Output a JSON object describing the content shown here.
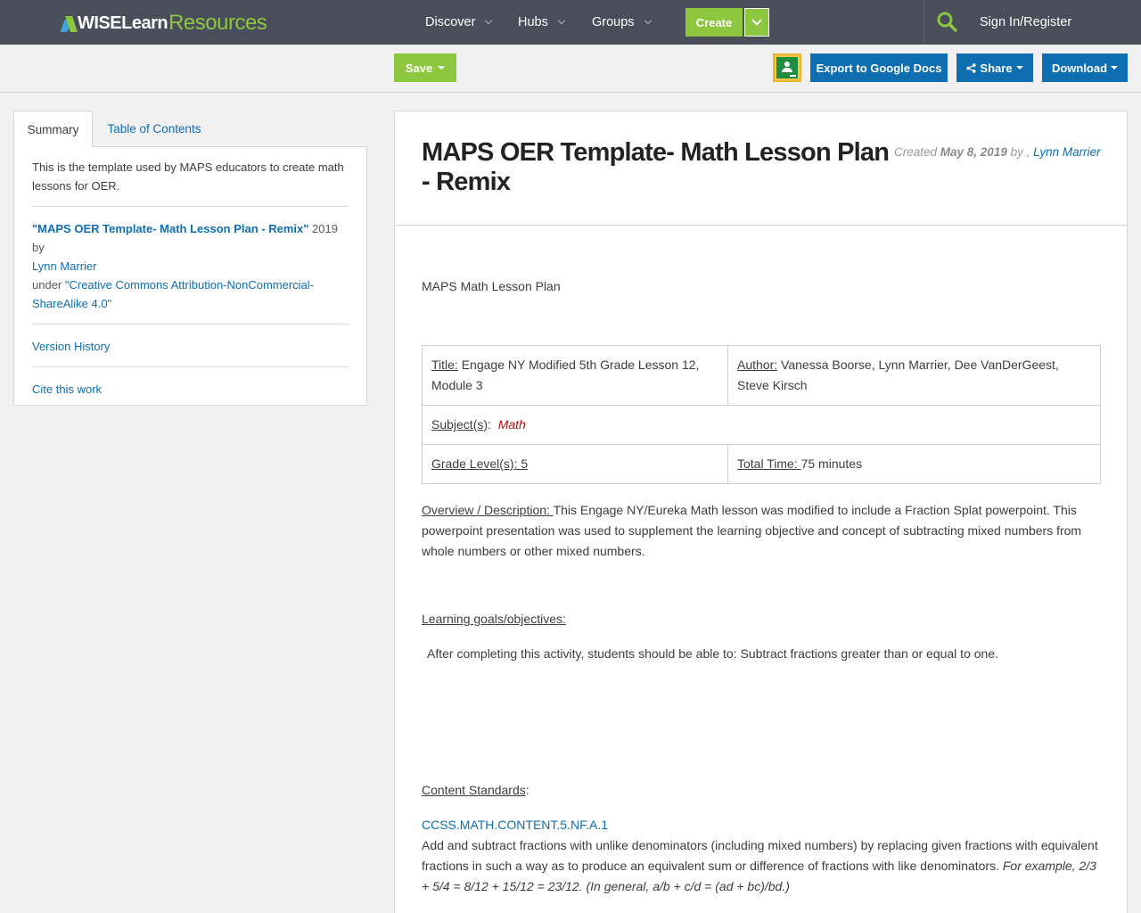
{
  "nav": {
    "logo_wise": "WISELearn",
    "logo_res": "Resources",
    "items": [
      {
        "label": "Discover"
      },
      {
        "label": "Hubs"
      },
      {
        "label": "Groups"
      }
    ],
    "create_label": "Create",
    "signin_label": "Sign In/Register"
  },
  "toolbar": {
    "save_label": "Save",
    "export_label": "Export to Google Docs",
    "share_label": "Share",
    "download_label": "Download"
  },
  "sidebar": {
    "tabs": [
      {
        "label": "Summary"
      },
      {
        "label": "Table of Contents"
      }
    ],
    "description": "This is the template used by MAPS educators to create math lessons for OER.",
    "citation": {
      "title": "\"MAPS OER Template- Math Lesson Plan - Remix\"",
      "year_by": " 2019 by",
      "author": "Lynn Marrier",
      "under": "under ",
      "license": "\"Creative Commons Attribution-NonCommercial-ShareAlike 4.0\""
    },
    "version_history": "Version History",
    "cite": "Cite this work"
  },
  "doc": {
    "title": "MAPS OER Template- Math Lesson Plan - Remix",
    "meta_created": "Created ",
    "meta_date": "May 8, 2019",
    "meta_by": " by , ",
    "meta_author": "Lynn Marrier",
    "lesson_plan_title": "MAPS Math Lesson Plan",
    "table": {
      "title_label": "Title:",
      "title_value": " Engage NY Modified 5th Grade Lesson 12, Module 3",
      "author_label": "Author:",
      "author_value": " Vanessa Boorse, Lynn Marrier, Dee VanDerGeest, Steve Kirsch",
      "subject_label": "Subject(s)",
      "subject_colon": ":  ",
      "subject_value": "Math",
      "grade_label": "Grade Level(s): ",
      "grade_value": "5",
      "time_label": "Total Time: ",
      "time_value": "75 minutes"
    },
    "overview_label": "Overview / Description: ",
    "overview_text": "This Engage NY/Eureka Math lesson was modified to include a Fraction Splat powerpoint.  This powerpoint presentation was used to supplement the learning objective and concept of subtracting mixed numbers from whole numbers or other mixed numbers.",
    "goals_label": "Learning goals/objectives:",
    "goals_text": "After completing this activity, students should be able to: Subtract fractions greater than or equal to one.",
    "standards_label": "Content Standards",
    "standards_colon": ":",
    "standard_code": "CCSS.MATH.CONTENT.5.NF.A.1",
    "standard_desc": "Add and subtract fractions with unlike denominators (including mixed numbers) by replacing given fractions with equivalent fractions in such a way as to produce an equivalent sum or difference of fractions with like denominators. ",
    "standard_example": "For example, 2/3 + 5/4 = 8/12 + 15/12 = 23/12. (In general, a/b + c/d = (ad + bc)/bd.)"
  }
}
